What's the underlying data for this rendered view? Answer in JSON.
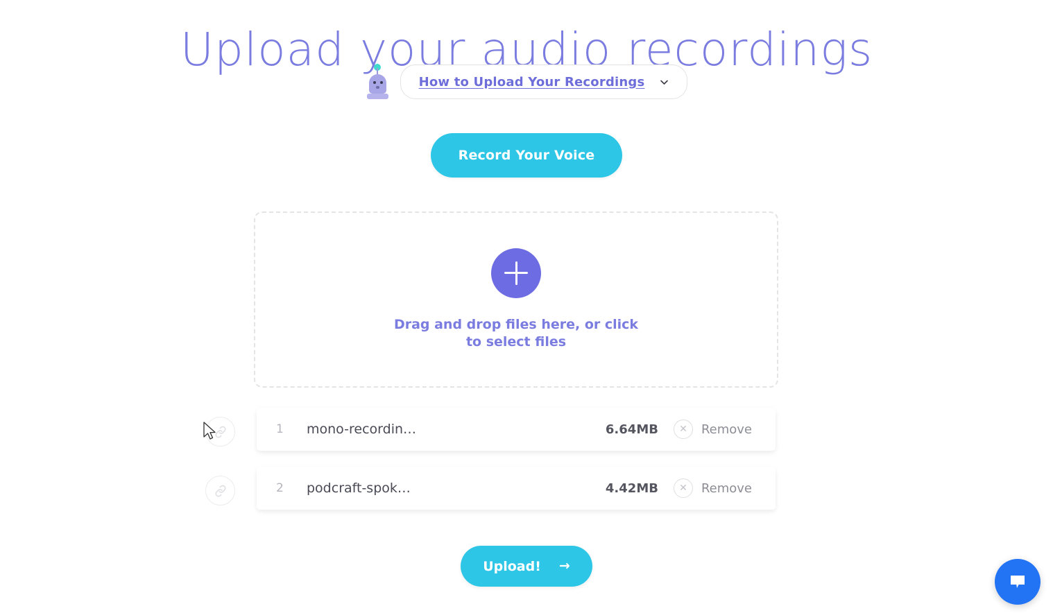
{
  "page": {
    "title": "Upload your audio recordings"
  },
  "howto": {
    "robot_icon": "robot-icon",
    "link_label": "How to Upload Your Recordings",
    "chevron_icon": "chevron-down-icon"
  },
  "record": {
    "label": "Record Your Voice"
  },
  "dropzone": {
    "plus_icon": "plus-icon",
    "text": "Drag and drop files here, or click to select files"
  },
  "files": {
    "remove_label": "Remove",
    "close_icon": "close-icon",
    "link_icon": "link-icon",
    "items": [
      {
        "index": "1",
        "name": "mono-recordin…",
        "size": "6.64MB"
      },
      {
        "index": "2",
        "name": "podcraft-spok…",
        "size": "4.42MB"
      }
    ]
  },
  "upload": {
    "label": "Upload!",
    "arrow": "→"
  },
  "chat": {
    "icon": "chat-bubble-icon"
  },
  "colors": {
    "purple": "#7b7ce0",
    "purple_deep": "#6d6ce2",
    "cyan": "#2ec6e6",
    "chat_blue": "#2374f5",
    "teal": "#3fd9cd",
    "text_gray": "#8d8d96"
  }
}
